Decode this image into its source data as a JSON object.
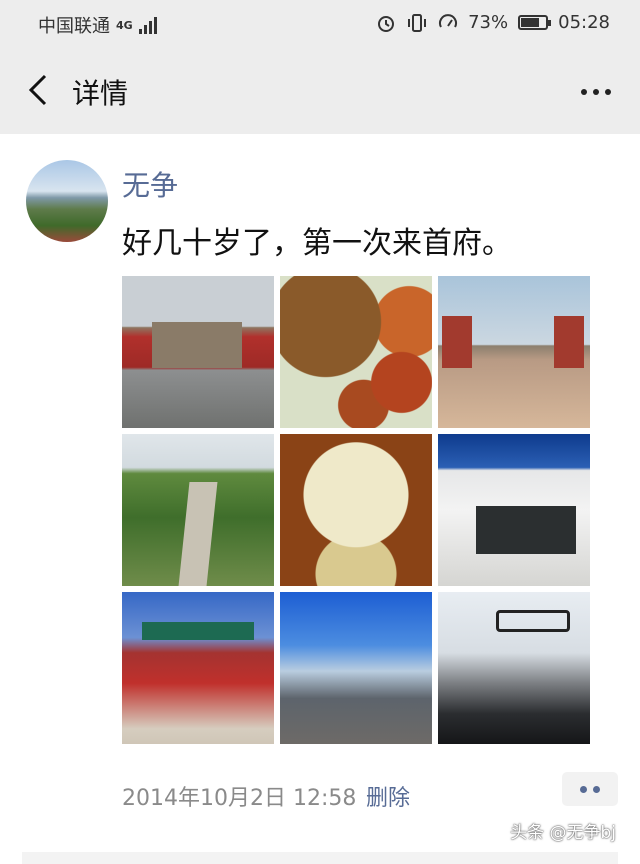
{
  "status_bar": {
    "carrier": "中国联通",
    "network": "4G",
    "battery": "73%",
    "battery_level": 0.73,
    "time": "05:28"
  },
  "nav": {
    "title": "详情",
    "back_icon": "chevron-left-icon",
    "more_icon": "more-horizontal-icon"
  },
  "post": {
    "author": "无争",
    "text": "好几十岁了，第一次来首府。",
    "timestamp": "2014年10月2日 12:58",
    "delete_label": "删除",
    "comment_icon": "comment-dots-icon"
  },
  "watermark": "头条 @无争bj",
  "colors": {
    "link": "#576b95",
    "nav_bg": "#ededed",
    "timestamp": "#8a8a8a"
  }
}
